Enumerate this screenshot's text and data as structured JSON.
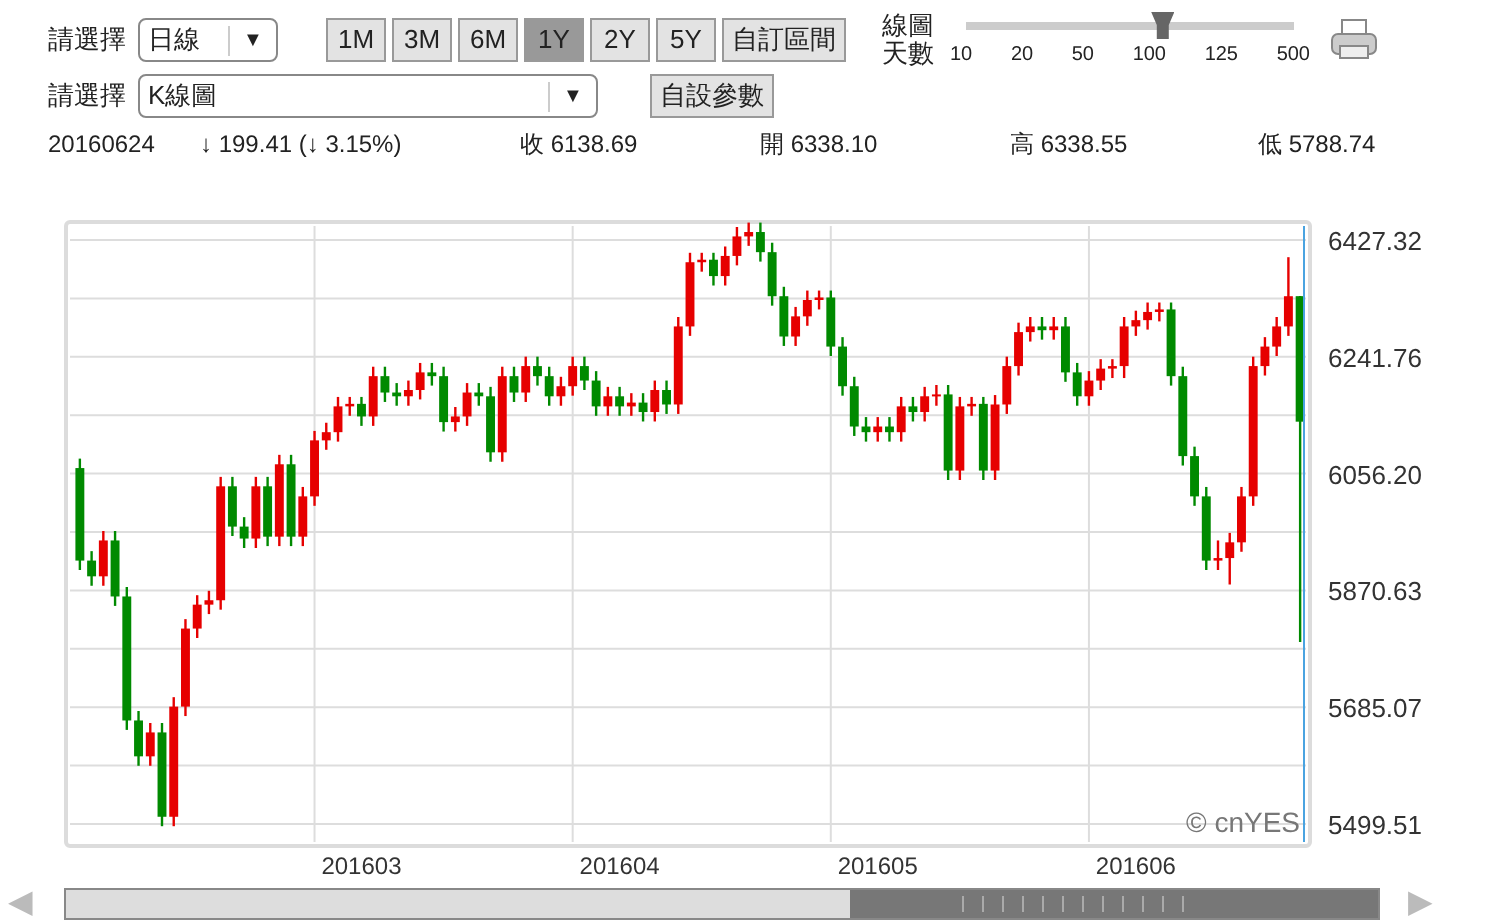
{
  "controls": {
    "row1": {
      "label": "請選擇",
      "select": {
        "value": "日線",
        "arrow": "▼"
      },
      "periods": [
        {
          "label": "1M",
          "selected": false
        },
        {
          "label": "3M",
          "selected": false
        },
        {
          "label": "6M",
          "selected": false
        },
        {
          "label": "1Y",
          "selected": true
        },
        {
          "label": "2Y",
          "selected": false
        },
        {
          "label": "5Y",
          "selected": false
        }
      ],
      "custom_range": "自訂區間",
      "days": {
        "label_line1": "線圖",
        "label_line2": "天數",
        "level": 0.6,
        "ticks": [
          "10",
          "20",
          "50",
          "100",
          "125",
          "500"
        ]
      }
    },
    "row2": {
      "label": "請選擇",
      "select": {
        "value": "K線圖",
        "arrow": "▼"
      },
      "button": "自設參數"
    }
  },
  "quote": {
    "date": "20160624",
    "change": "↓ 199.41 (↓ 3.15%)",
    "close": "收 6138.69",
    "open": "開 6338.10",
    "high": "高 6338.55",
    "low": "低 5788.74"
  },
  "chart": {
    "credit": "© cnYES",
    "chart_data": {
      "type": "candlestick",
      "categories": [
        null,
        null,
        null,
        null,
        null,
        null,
        null,
        null,
        null,
        null,
        null,
        null,
        null,
        null,
        null,
        null,
        null,
        null,
        null,
        null,
        null,
        null,
        null,
        null,
        "201603",
        null,
        null,
        null,
        null,
        null,
        null,
        null,
        null,
        null,
        null,
        null,
        null,
        null,
        null,
        null,
        null,
        null,
        null,
        null,
        null,
        null,
        "201604",
        null,
        null,
        null,
        null,
        null,
        null,
        null,
        null,
        null,
        null,
        null,
        null,
        null,
        null,
        null,
        null,
        null,
        null,
        null,
        null,
        null,
        "201605",
        null,
        null,
        null,
        null,
        null,
        null,
        null,
        null,
        null,
        null,
        null,
        null,
        null,
        null,
        null,
        null,
        null,
        null,
        null,
        null,
        null,
        "201606",
        null,
        null,
        null,
        null,
        null,
        null,
        null,
        null,
        null,
        null,
        null,
        null,
        null,
        null
      ],
      "ohlc": [
        [
          6065,
          6080,
          5903,
          5918
        ],
        [
          5918,
          5933,
          5878,
          5893
        ],
        [
          5893,
          5965,
          5878,
          5950
        ],
        [
          5950,
          5965,
          5846,
          5861
        ],
        [
          5861,
          5876,
          5649,
          5664
        ],
        [
          5664,
          5679,
          5592,
          5607
        ],
        [
          5607,
          5660,
          5592,
          5645
        ],
        [
          5645,
          5660,
          5496,
          5511
        ],
        [
          5511,
          5701,
          5496,
          5686
        ],
        [
          5686,
          5825,
          5671,
          5810
        ],
        [
          5810,
          5863,
          5795,
          5848
        ],
        [
          5848,
          5870,
          5833,
          5855
        ],
        [
          5855,
          6051,
          5840,
          6036
        ],
        [
          6036,
          6051,
          5957,
          5972
        ],
        [
          5972,
          5987,
          5938,
          5953
        ],
        [
          5953,
          6051,
          5938,
          6036
        ],
        [
          6036,
          6051,
          5941,
          5956
        ],
        [
          5956,
          6086,
          5941,
          6071
        ],
        [
          6071,
          6086,
          5941,
          5956
        ],
        [
          5956,
          6035,
          5941,
          6020
        ],
        [
          6020,
          6124,
          6005,
          6109
        ],
        [
          6109,
          6137,
          6094,
          6122
        ],
        [
          6122,
          6178,
          6107,
          6163
        ],
        [
          6163,
          6178,
          6148,
          6167
        ],
        [
          6167,
          6178,
          6132,
          6147
        ],
        [
          6147,
          6226,
          6132,
          6211
        ],
        [
          6211,
          6226,
          6170,
          6185
        ],
        [
          6185,
          6200,
          6164,
          6179
        ],
        [
          6179,
          6204,
          6164,
          6189
        ],
        [
          6189,
          6232,
          6174,
          6217
        ],
        [
          6217,
          6232,
          6196,
          6211
        ],
        [
          6211,
          6226,
          6123,
          6138
        ],
        [
          6138,
          6162,
          6123,
          6147
        ],
        [
          6147,
          6200,
          6132,
          6185
        ],
        [
          6185,
          6200,
          6164,
          6179
        ],
        [
          6179,
          6194,
          6075,
          6090
        ],
        [
          6090,
          6226,
          6075,
          6211
        ],
        [
          6211,
          6226,
          6170,
          6185
        ],
        [
          6185,
          6242,
          6170,
          6227
        ],
        [
          6227,
          6242,
          6196,
          6211
        ],
        [
          6211,
          6226,
          6164,
          6179
        ],
        [
          6179,
          6210,
          6164,
          6195
        ],
        [
          6195,
          6242,
          6180,
          6227
        ],
        [
          6227,
          6242,
          6189,
          6204
        ],
        [
          6204,
          6219,
          6148,
          6163
        ],
        [
          6163,
          6194,
          6148,
          6179
        ],
        [
          6179,
          6194,
          6148,
          6163
        ],
        [
          6163,
          6184,
          6148,
          6169
        ],
        [
          6169,
          6184,
          6139,
          6154
        ],
        [
          6154,
          6204,
          6139,
          6189
        ],
        [
          6189,
          6204,
          6151,
          6166
        ],
        [
          6166,
          6305,
          6151,
          6290
        ],
        [
          6290,
          6407,
          6275,
          6392
        ],
        [
          6392,
          6407,
          6377,
          6396
        ],
        [
          6396,
          6407,
          6355,
          6370
        ],
        [
          6370,
          6417,
          6355,
          6402
        ],
        [
          6402,
          6448,
          6387,
          6433
        ],
        [
          6433,
          6455,
          6418,
          6440
        ],
        [
          6440,
          6455,
          6393,
          6408
        ],
        [
          6408,
          6423,
          6323,
          6338
        ],
        [
          6338,
          6353,
          6259,
          6274
        ],
        [
          6274,
          6321,
          6259,
          6306
        ],
        [
          6306,
          6347,
          6291,
          6332
        ],
        [
          6332,
          6347,
          6317,
          6336
        ],
        [
          6336,
          6347,
          6243,
          6258
        ],
        [
          6258,
          6273,
          6180,
          6195
        ],
        [
          6195,
          6210,
          6116,
          6131
        ],
        [
          6131,
          6146,
          6107,
          6122
        ],
        [
          6122,
          6146,
          6107,
          6131
        ],
        [
          6131,
          6146,
          6107,
          6122
        ],
        [
          6122,
          6178,
          6107,
          6163
        ],
        [
          6163,
          6178,
          6139,
          6154
        ],
        [
          6154,
          6194,
          6139,
          6179
        ],
        [
          6179,
          6197,
          6164,
          6182
        ],
        [
          6182,
          6197,
          6046,
          6061
        ],
        [
          6061,
          6178,
          6046,
          6163
        ],
        [
          6163,
          6178,
          6148,
          6167
        ],
        [
          6167,
          6178,
          6046,
          6061
        ],
        [
          6061,
          6181,
          6046,
          6166
        ],
        [
          6166,
          6242,
          6151,
          6227
        ],
        [
          6227,
          6296,
          6212,
          6281
        ],
        [
          6281,
          6305,
          6266,
          6290
        ],
        [
          6290,
          6305,
          6269,
          6284
        ],
        [
          6284,
          6305,
          6269,
          6290
        ],
        [
          6290,
          6305,
          6202,
          6217
        ],
        [
          6217,
          6232,
          6164,
          6179
        ],
        [
          6179,
          6219,
          6164,
          6204
        ],
        [
          6204,
          6238,
          6189,
          6223
        ],
        [
          6223,
          6238,
          6208,
          6227
        ],
        [
          6227,
          6305,
          6208,
          6290
        ],
        [
          6290,
          6315,
          6275,
          6300
        ],
        [
          6300,
          6328,
          6285,
          6313
        ],
        [
          6313,
          6328,
          6298,
          6317
        ],
        [
          6317,
          6328,
          6196,
          6211
        ],
        [
          6211,
          6226,
          6069,
          6084
        ],
        [
          6084,
          6099,
          6005,
          6020
        ],
        [
          6020,
          6035,
          5903,
          5918
        ],
        [
          5918,
          5950,
          5903,
          5922
        ],
        [
          5922,
          5962,
          5880,
          5947
        ],
        [
          5947,
          6035,
          5932,
          6020
        ],
        [
          6020,
          6242,
          6005,
          6227
        ],
        [
          6227,
          6273,
          6212,
          6258
        ],
        [
          6258,
          6305,
          6243,
          6290
        ],
        [
          6290,
          6400,
          6275,
          6338
        ],
        [
          6338.1,
          6338.55,
          5788.74,
          6138.69
        ]
      ],
      "ylim": [
        5499.51,
        6427.32
      ],
      "grid": true,
      "yticks": [
        {
          "value": 6427.32,
          "label": "6427.32"
        },
        {
          "value": 6241.76,
          "label": "6241.76"
        },
        {
          "value": 6056.2,
          "label": "6056.20"
        },
        {
          "value": 5870.63,
          "label": "5870.63"
        },
        {
          "value": 5685.07,
          "label": "5685.07"
        },
        {
          "value": 5499.51,
          "label": "5499.51"
        }
      ]
    }
  },
  "scrollbar": {
    "left": "◀",
    "right": "▶"
  }
}
